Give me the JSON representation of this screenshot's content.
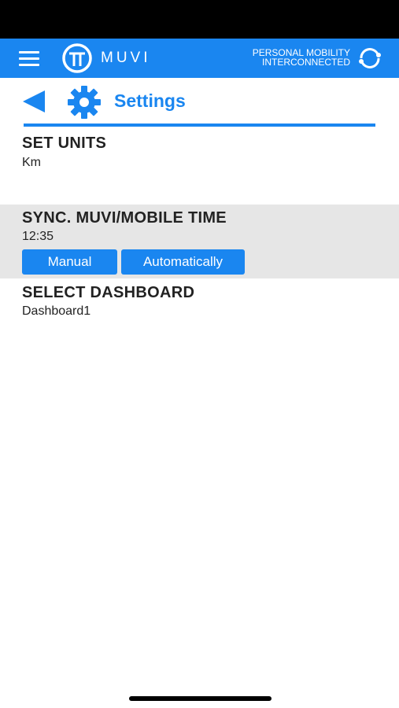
{
  "app": {
    "name": "MUVI",
    "tagline_line1": "PERSONAL MOBILITY",
    "tagline_line2": "INTERCONNECTED",
    "brand_color": "#1a86f0"
  },
  "icons": {
    "menu": "hamburger-menu-icon",
    "logo": "muvi-logo-icon",
    "sync": "sync-arrows-icon",
    "back": "back-arrow-icon",
    "settings": "gear-icon"
  },
  "page": {
    "title": "Settings"
  },
  "settings": {
    "units": {
      "label": "SET UNITS",
      "value": "Km"
    },
    "sync_time": {
      "label": "SYNC. MUVI/MOBILE TIME",
      "value": "12:35",
      "manual_label": "Manual",
      "auto_label": "Automatically"
    },
    "dashboard": {
      "label": "SELECT DASHBOARD",
      "value": "Dashboard1"
    }
  }
}
